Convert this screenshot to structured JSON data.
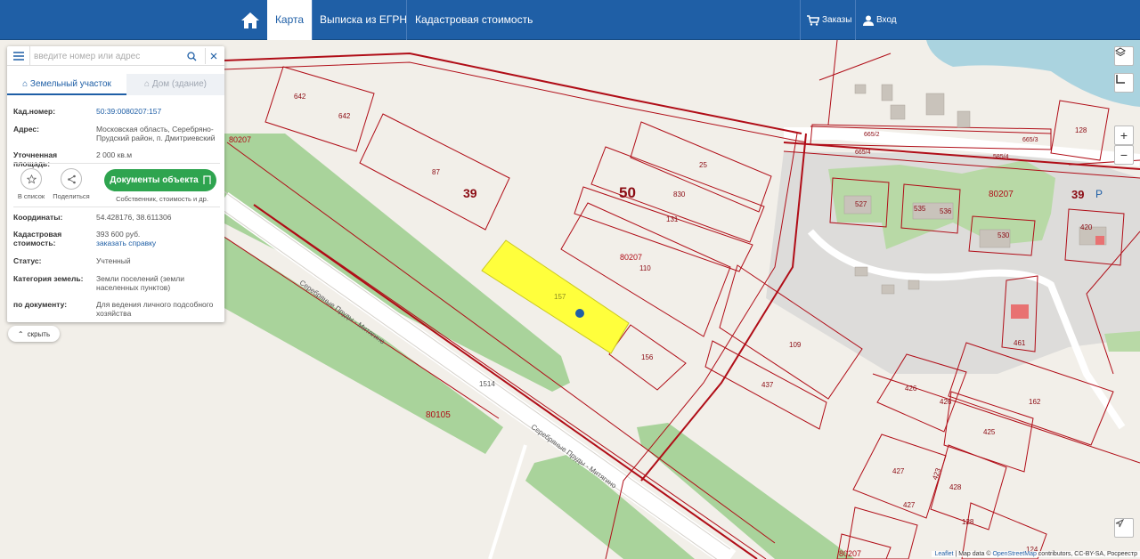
{
  "nav": {
    "home_icon": "home-icon",
    "tabs": [
      "Карта",
      "Выписка из ЕГРН",
      "Кадастровая стоимость"
    ],
    "orders": "Заказы",
    "login": "Вход"
  },
  "search": {
    "placeholder": "введите номер или адрес"
  },
  "panel": {
    "tab_land": "Земельный участок",
    "tab_house": "Дом (здание)",
    "fields": {
      "cad_label": "Кад.номер:",
      "cad_value": "50:39:0080207:157",
      "addr_label": "Адрес:",
      "addr_value": "Московская область, Серебряно-Прудский район, п. Дмитриевский",
      "area_label": "Уточненная площадь:",
      "area_value": "2 000 кв.м",
      "coords_label": "Координаты:",
      "coords_value": "54.428176, 38.611306",
      "cost_label": "Кадастровая стоимость:",
      "cost_value": "393 600 руб.",
      "cost_link": "заказать справку",
      "status_label": "Статус:",
      "status_value": "Учтенный",
      "category_label": "Категория земель:",
      "category_value": "Земли поселений (земли населенных пунктов)",
      "doc_label": "по документу:",
      "doc_value": "Для ведения личного подсобного хозяйства"
    },
    "actions": {
      "fav": "В список",
      "share": "Поделиться",
      "docs_button": "Документы объекта",
      "docs_sub": "Собственник, стоимость и др."
    },
    "hide": "скрыть"
  },
  "map_labels": {
    "q80207_a": "80207",
    "q80207_b": "80207",
    "q80207_c": "80207",
    "q80207_d": "80207",
    "q80105": "80105",
    "big39_a": "39",
    "big50": "50",
    "big39_b": "39",
    "p": "P",
    "n642a": "642",
    "n642b": "642",
    "n87": "87",
    "n25": "25",
    "n830": "830",
    "n131": "131",
    "n110": "110",
    "n157": "157",
    "n156": "156",
    "n109": "109",
    "n437": "437",
    "n1514": "1514",
    "n665_2": "665/2",
    "n665_4": "665/4",
    "n665_3": "665/3",
    "n585_4": "585/4",
    "n128a": "128",
    "n527": "527",
    "n535": "535",
    "n536": "536",
    "n530": "530",
    "n420": "420",
    "n461": "461",
    "n426a": "426",
    "n426b": "426",
    "n162": "162",
    "n425": "425",
    "n427a": "427",
    "n427b": "427",
    "n423": "423",
    "n428": "428",
    "n128b": "128",
    "n124": "124",
    "road1": "Серебряные Пруды - Митягино",
    "road2": "Серебряные Пруды - Митягино"
  },
  "attribution": {
    "leaflet": "Leaflet",
    "text": " | Map data © ",
    "osm": "OpenStreetMap",
    "rest": " contributors, CC-BY-SA, Росреестр"
  },
  "colors": {
    "nav_bg": "#1f5fa6",
    "parcel_border": "#b00d17",
    "selected_parcel": "#ffff3c",
    "green_area": "#a9d39b",
    "water": "#aad3df",
    "marker": "#1f5fa6",
    "docs_button": "#2ea44f"
  }
}
